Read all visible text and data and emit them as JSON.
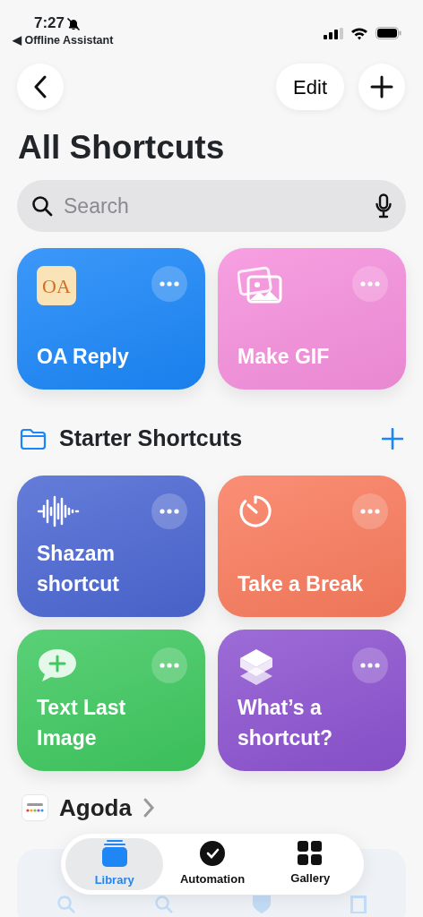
{
  "status_bar": {
    "time": "7:27",
    "back_app": "◀ Offline Assistant",
    "silent": true
  },
  "nav": {
    "edit": "Edit"
  },
  "title": "All Shortcuts",
  "search": {
    "placeholder": "Search"
  },
  "top_shortcuts": [
    {
      "name": "OA Reply",
      "kind": "app",
      "icon_text": "OA",
      "color": "#1a86f8"
    },
    {
      "name": "Make GIF",
      "kind": "photos",
      "color": "#f58fdc"
    }
  ],
  "folder": {
    "name": "Starter Shortcuts"
  },
  "starter_shortcuts": [
    {
      "name": "Shazam shortcut",
      "kind": "wave",
      "color": "#4a66d2"
    },
    {
      "name": "Take a Break",
      "kind": "timer",
      "color": "#f97b5d"
    },
    {
      "name": "Text Last Image",
      "kind": "message",
      "color": "#3ec85f"
    },
    {
      "name": "What’s a shortcut?",
      "kind": "layers",
      "color": "#8c52d0"
    }
  ],
  "app_section": {
    "name": "Agoda"
  },
  "tabs": [
    {
      "label": "Library",
      "selected": true
    },
    {
      "label": "Automation",
      "selected": false
    },
    {
      "label": "Gallery",
      "selected": false
    }
  ]
}
